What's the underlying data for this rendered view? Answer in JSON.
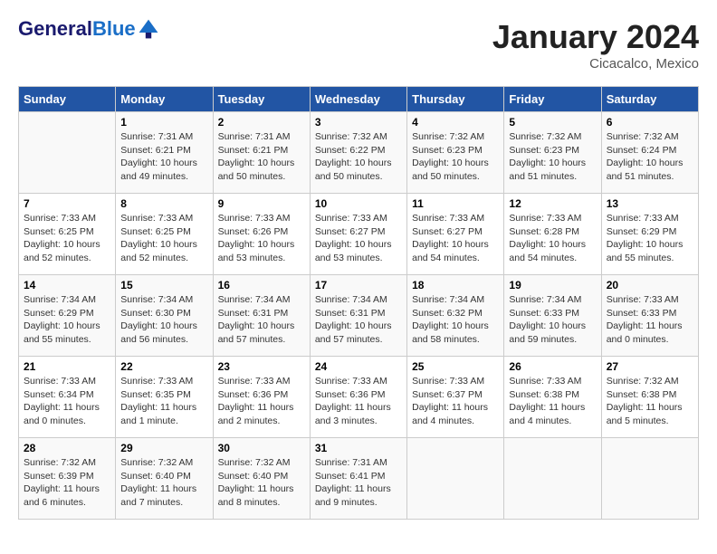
{
  "header": {
    "logo_line1": "General",
    "logo_line2": "Blue",
    "month": "January 2024",
    "location": "Cicacalco, Mexico"
  },
  "weekdays": [
    "Sunday",
    "Monday",
    "Tuesday",
    "Wednesday",
    "Thursday",
    "Friday",
    "Saturday"
  ],
  "weeks": [
    [
      {
        "day": "",
        "sunrise": "",
        "sunset": "",
        "daylight": ""
      },
      {
        "day": "1",
        "sunrise": "Sunrise: 7:31 AM",
        "sunset": "Sunset: 6:21 PM",
        "daylight": "Daylight: 10 hours and 49 minutes."
      },
      {
        "day": "2",
        "sunrise": "Sunrise: 7:31 AM",
        "sunset": "Sunset: 6:21 PM",
        "daylight": "Daylight: 10 hours and 50 minutes."
      },
      {
        "day": "3",
        "sunrise": "Sunrise: 7:32 AM",
        "sunset": "Sunset: 6:22 PM",
        "daylight": "Daylight: 10 hours and 50 minutes."
      },
      {
        "day": "4",
        "sunrise": "Sunrise: 7:32 AM",
        "sunset": "Sunset: 6:23 PM",
        "daylight": "Daylight: 10 hours and 50 minutes."
      },
      {
        "day": "5",
        "sunrise": "Sunrise: 7:32 AM",
        "sunset": "Sunset: 6:23 PM",
        "daylight": "Daylight: 10 hours and 51 minutes."
      },
      {
        "day": "6",
        "sunrise": "Sunrise: 7:32 AM",
        "sunset": "Sunset: 6:24 PM",
        "daylight": "Daylight: 10 hours and 51 minutes."
      }
    ],
    [
      {
        "day": "7",
        "sunrise": "Sunrise: 7:33 AM",
        "sunset": "Sunset: 6:25 PM",
        "daylight": "Daylight: 10 hours and 52 minutes."
      },
      {
        "day": "8",
        "sunrise": "Sunrise: 7:33 AM",
        "sunset": "Sunset: 6:25 PM",
        "daylight": "Daylight: 10 hours and 52 minutes."
      },
      {
        "day": "9",
        "sunrise": "Sunrise: 7:33 AM",
        "sunset": "Sunset: 6:26 PM",
        "daylight": "Daylight: 10 hours and 53 minutes."
      },
      {
        "day": "10",
        "sunrise": "Sunrise: 7:33 AM",
        "sunset": "Sunset: 6:27 PM",
        "daylight": "Daylight: 10 hours and 53 minutes."
      },
      {
        "day": "11",
        "sunrise": "Sunrise: 7:33 AM",
        "sunset": "Sunset: 6:27 PM",
        "daylight": "Daylight: 10 hours and 54 minutes."
      },
      {
        "day": "12",
        "sunrise": "Sunrise: 7:33 AM",
        "sunset": "Sunset: 6:28 PM",
        "daylight": "Daylight: 10 hours and 54 minutes."
      },
      {
        "day": "13",
        "sunrise": "Sunrise: 7:33 AM",
        "sunset": "Sunset: 6:29 PM",
        "daylight": "Daylight: 10 hours and 55 minutes."
      }
    ],
    [
      {
        "day": "14",
        "sunrise": "Sunrise: 7:34 AM",
        "sunset": "Sunset: 6:29 PM",
        "daylight": "Daylight: 10 hours and 55 minutes."
      },
      {
        "day": "15",
        "sunrise": "Sunrise: 7:34 AM",
        "sunset": "Sunset: 6:30 PM",
        "daylight": "Daylight: 10 hours and 56 minutes."
      },
      {
        "day": "16",
        "sunrise": "Sunrise: 7:34 AM",
        "sunset": "Sunset: 6:31 PM",
        "daylight": "Daylight: 10 hours and 57 minutes."
      },
      {
        "day": "17",
        "sunrise": "Sunrise: 7:34 AM",
        "sunset": "Sunset: 6:31 PM",
        "daylight": "Daylight: 10 hours and 57 minutes."
      },
      {
        "day": "18",
        "sunrise": "Sunrise: 7:34 AM",
        "sunset": "Sunset: 6:32 PM",
        "daylight": "Daylight: 10 hours and 58 minutes."
      },
      {
        "day": "19",
        "sunrise": "Sunrise: 7:34 AM",
        "sunset": "Sunset: 6:33 PM",
        "daylight": "Daylight: 10 hours and 59 minutes."
      },
      {
        "day": "20",
        "sunrise": "Sunrise: 7:33 AM",
        "sunset": "Sunset: 6:33 PM",
        "daylight": "Daylight: 11 hours and 0 minutes."
      }
    ],
    [
      {
        "day": "21",
        "sunrise": "Sunrise: 7:33 AM",
        "sunset": "Sunset: 6:34 PM",
        "daylight": "Daylight: 11 hours and 0 minutes."
      },
      {
        "day": "22",
        "sunrise": "Sunrise: 7:33 AM",
        "sunset": "Sunset: 6:35 PM",
        "daylight": "Daylight: 11 hours and 1 minute."
      },
      {
        "day": "23",
        "sunrise": "Sunrise: 7:33 AM",
        "sunset": "Sunset: 6:36 PM",
        "daylight": "Daylight: 11 hours and 2 minutes."
      },
      {
        "day": "24",
        "sunrise": "Sunrise: 7:33 AM",
        "sunset": "Sunset: 6:36 PM",
        "daylight": "Daylight: 11 hours and 3 minutes."
      },
      {
        "day": "25",
        "sunrise": "Sunrise: 7:33 AM",
        "sunset": "Sunset: 6:37 PM",
        "daylight": "Daylight: 11 hours and 4 minutes."
      },
      {
        "day": "26",
        "sunrise": "Sunrise: 7:33 AM",
        "sunset": "Sunset: 6:38 PM",
        "daylight": "Daylight: 11 hours and 4 minutes."
      },
      {
        "day": "27",
        "sunrise": "Sunrise: 7:32 AM",
        "sunset": "Sunset: 6:38 PM",
        "daylight": "Daylight: 11 hours and 5 minutes."
      }
    ],
    [
      {
        "day": "28",
        "sunrise": "Sunrise: 7:32 AM",
        "sunset": "Sunset: 6:39 PM",
        "daylight": "Daylight: 11 hours and 6 minutes."
      },
      {
        "day": "29",
        "sunrise": "Sunrise: 7:32 AM",
        "sunset": "Sunset: 6:40 PM",
        "daylight": "Daylight: 11 hours and 7 minutes."
      },
      {
        "day": "30",
        "sunrise": "Sunrise: 7:32 AM",
        "sunset": "Sunset: 6:40 PM",
        "daylight": "Daylight: 11 hours and 8 minutes."
      },
      {
        "day": "31",
        "sunrise": "Sunrise: 7:31 AM",
        "sunset": "Sunset: 6:41 PM",
        "daylight": "Daylight: 11 hours and 9 minutes."
      },
      {
        "day": "",
        "sunrise": "",
        "sunset": "",
        "daylight": ""
      },
      {
        "day": "",
        "sunrise": "",
        "sunset": "",
        "daylight": ""
      },
      {
        "day": "",
        "sunrise": "",
        "sunset": "",
        "daylight": ""
      }
    ]
  ]
}
